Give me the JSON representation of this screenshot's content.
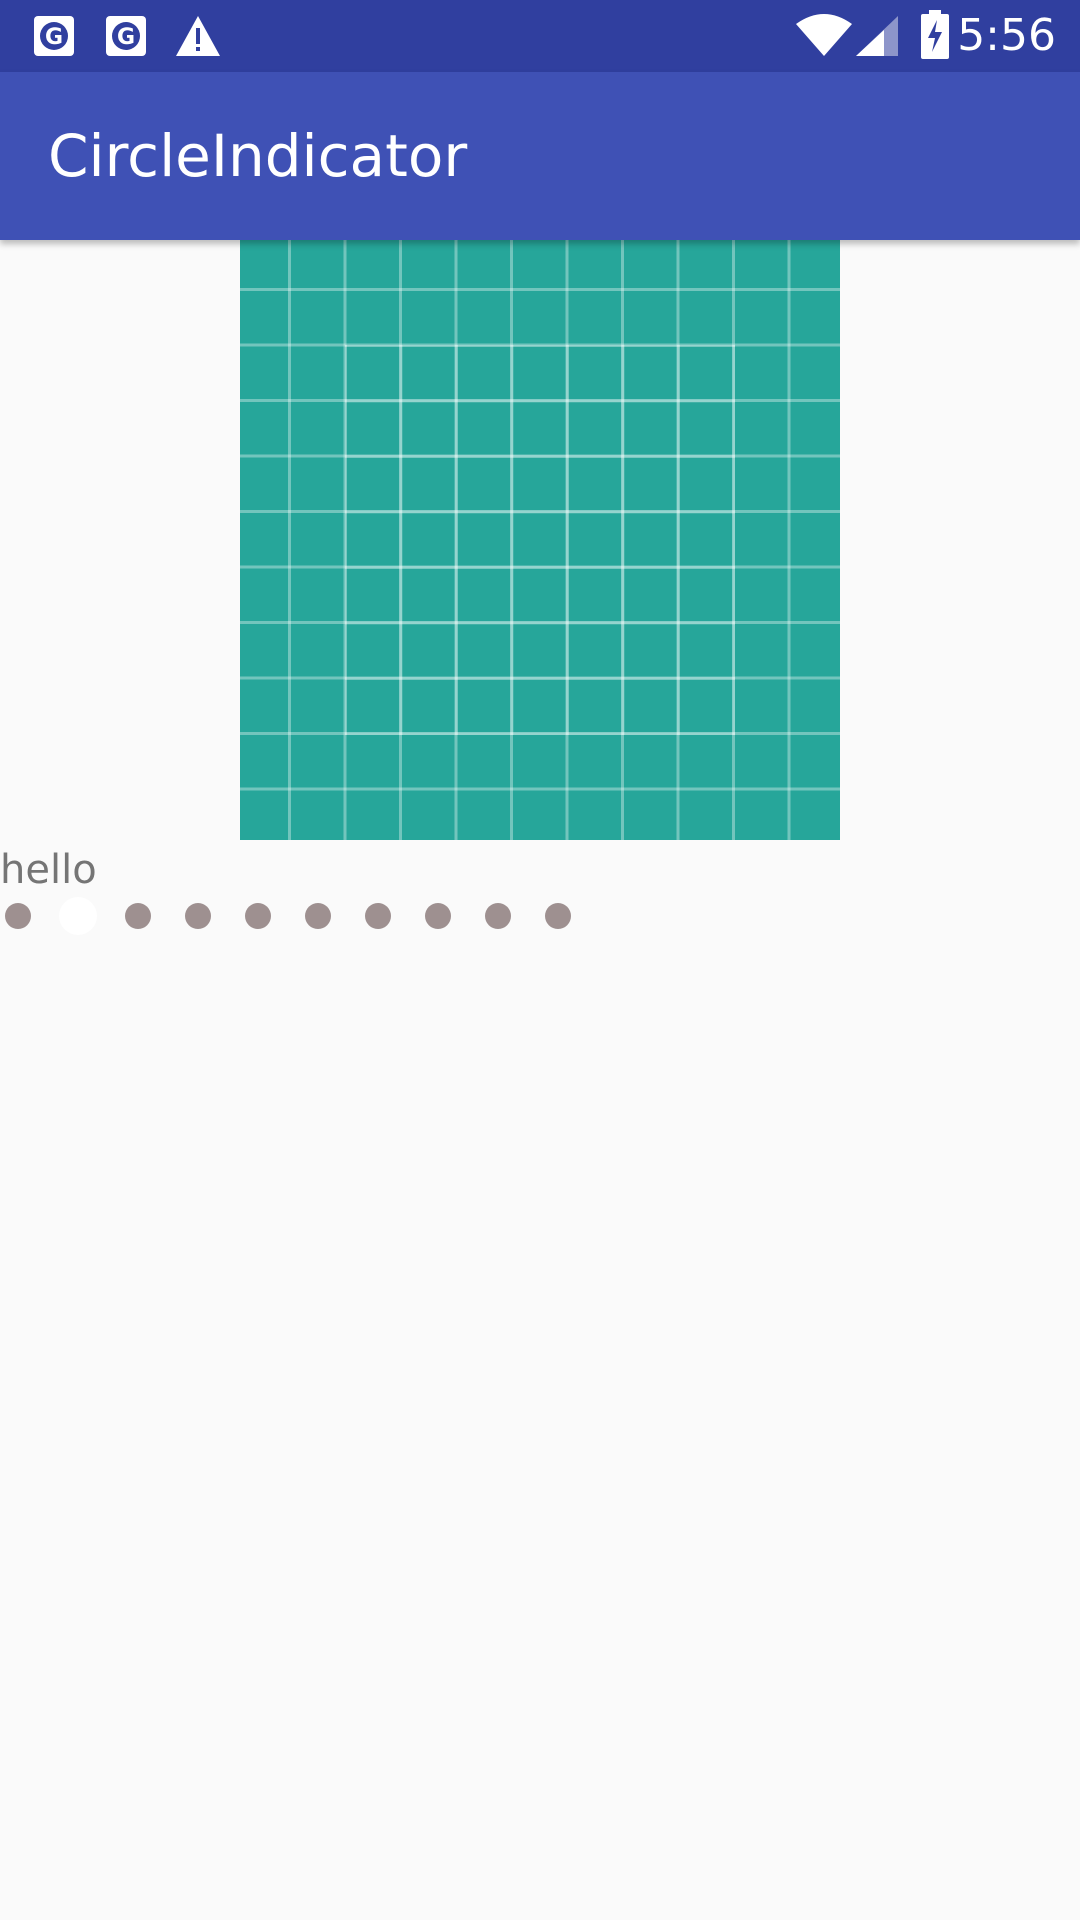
{
  "status_bar": {
    "time": "5:56",
    "left_icons": [
      "google-notification-icon",
      "google-notification-icon",
      "warning-icon"
    ],
    "right_icons": [
      "wifi-icon",
      "signal-icon",
      "battery-charging-icon"
    ]
  },
  "app_bar": {
    "title": "CircleIndicator"
  },
  "pager": {
    "background_color": "#26a69a",
    "page_icon": "grid-pattern-image"
  },
  "label": {
    "text": "hello"
  },
  "indicator": {
    "dot_count": 10,
    "active_index": 1,
    "active_color": "#ffffff",
    "inactive_color": "#9e9090"
  },
  "colors": {
    "status_bar": "#303f9f",
    "app_bar": "#3f51b5",
    "background": "#fafafa"
  }
}
